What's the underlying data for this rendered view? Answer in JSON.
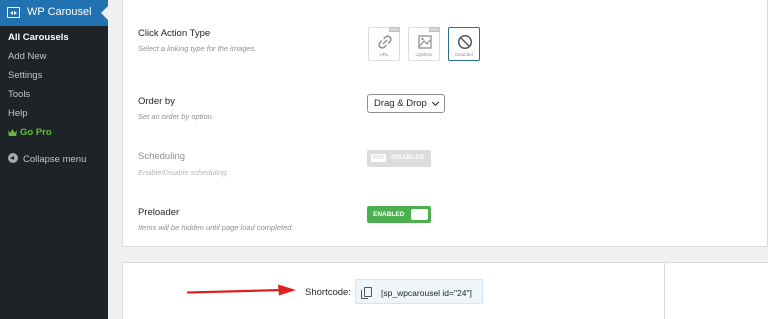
{
  "sidebar": {
    "title": "WP Carousel",
    "items": [
      {
        "label": "All Carousels"
      },
      {
        "label": "Add New"
      },
      {
        "label": "Settings"
      },
      {
        "label": "Tools"
      },
      {
        "label": "Help"
      },
      {
        "label": "Go Pro"
      }
    ],
    "collapse": "Collapse menu"
  },
  "settings": {
    "click_action": {
      "label": "Click Action Type",
      "desc": "Select a linking type for the images.",
      "options": [
        {
          "caption": "URL",
          "badge": "PRO"
        },
        {
          "caption": "Lightbox",
          "badge": "PRO"
        },
        {
          "caption": "Disabled"
        }
      ]
    },
    "order_by": {
      "label": "Order by",
      "desc": "Set an order by option.",
      "value": "Drag & Drop"
    },
    "scheduling": {
      "label": "Scheduling",
      "desc": "Enable/Disable scheduling.",
      "badge": "PRO",
      "state": "DISABLED"
    },
    "preloader": {
      "label": "Preloader",
      "desc": "Items will be hidden until page load completed.",
      "state": "ENABLED"
    }
  },
  "shortcode": {
    "label": "Shortcode:",
    "value": "[sp_wpcarousel id=\"24\"]"
  },
  "colors": {
    "sidebar_bg": "#1d2327",
    "sidebar_active": "#2271b1",
    "enabled_green": "#4caf50",
    "arrow_red": "#e02020"
  }
}
